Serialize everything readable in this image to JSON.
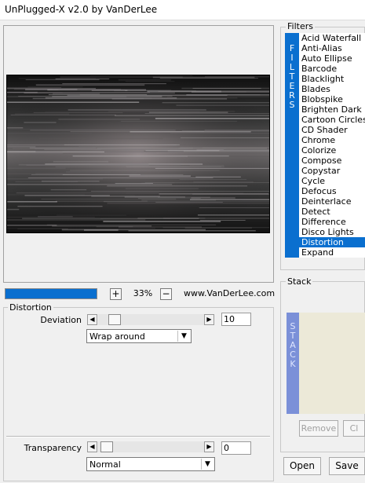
{
  "window": {
    "title": "UnPlugged-X v2.0 by VanDerLee"
  },
  "preview": {
    "zoom": "33%",
    "zoom_in_symbol": "+",
    "zoom_out_symbol": "−",
    "website": "www.VanDerLee.com",
    "progress_fraction": 1.0
  },
  "filters": {
    "group_label": "Filters",
    "vertical_label": "F\nI\nL\nT\nE\nR\nS",
    "items": [
      "Acid Waterfall",
      "Anti-Alias",
      "Auto Ellipse",
      "Barcode",
      "Blacklight",
      "Blades",
      "Blobspike",
      "Brighten Dark",
      "Cartoon Circles",
      "CD Shader",
      "Chrome",
      "Colorize",
      "Compose",
      "Copystar",
      "Cycle",
      "Defocus",
      "Deinterlace",
      "Detect",
      "Difference",
      "Disco Lights",
      "Distortion",
      "Expand"
    ],
    "selected": "Distortion"
  },
  "distortion": {
    "group_label": "Distortion",
    "deviation": {
      "label": "Deviation",
      "value": "10"
    },
    "edge_mode": "Wrap around",
    "transparency": {
      "label": "Transparency",
      "value": "0"
    },
    "blend_mode": "Normal"
  },
  "stack": {
    "group_label": "Stack",
    "vertical_label": "S\nT\nA\nC\nK",
    "remove_label": "Remove",
    "clear_label": "Cl"
  },
  "buttons": {
    "open_label": "Open",
    "save_label": "Save"
  },
  "colors": {
    "accent": "#0a6fcf",
    "stack_bar": "#7b90d8",
    "stack_bg": "#ece9d8"
  },
  "icons": {
    "left_arrow": "triangle-left",
    "right_arrow": "triangle-right",
    "dropdown": "triangle-down"
  }
}
